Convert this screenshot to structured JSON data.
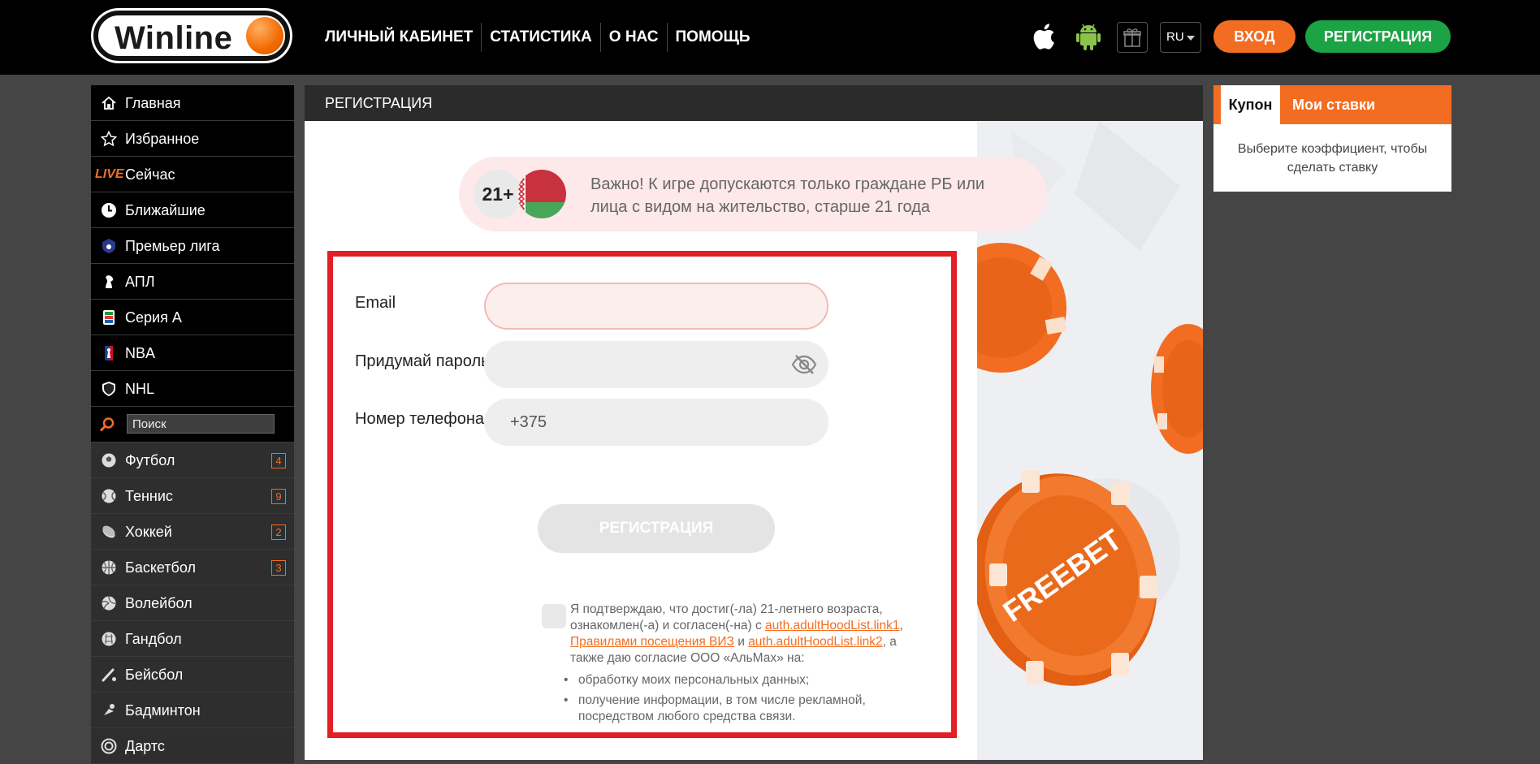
{
  "header": {
    "logo_text": "Winline",
    "nav": [
      "ЛИЧНЫЙ КАБИНЕТ",
      "СТАТИСТИКА",
      "О НАС",
      "ПОМОЩЬ"
    ],
    "lang": "RU",
    "login_label": "ВХОД",
    "register_label": "РЕГИСТРАЦИЯ"
  },
  "sidebar": {
    "top_items": [
      {
        "label": "Главная",
        "icon": "home-icon"
      },
      {
        "label": "Избранное",
        "icon": "star-icon"
      },
      {
        "label": "Сейчас",
        "icon": "live-icon",
        "tag": "LIVE"
      },
      {
        "label": "Ближайшие",
        "icon": "clock-icon"
      },
      {
        "label": "Премьер лига",
        "icon": "premier-league-icon"
      },
      {
        "label": "АПЛ",
        "icon": "epl-icon"
      },
      {
        "label": "Серия А",
        "icon": "serie-a-icon"
      },
      {
        "label": "NBA",
        "icon": "nba-icon"
      },
      {
        "label": "NHL",
        "icon": "nhl-icon"
      }
    ],
    "search_placeholder": "Поиск",
    "sports": [
      {
        "label": "Футбол",
        "count": "4",
        "icon": "football-icon"
      },
      {
        "label": "Теннис",
        "count": "9",
        "icon": "tennis-icon"
      },
      {
        "label": "Хоккей",
        "count": "2",
        "icon": "hockey-icon"
      },
      {
        "label": "Баскетбол",
        "count": "3",
        "icon": "basketball-icon"
      },
      {
        "label": "Волейбол",
        "count": "",
        "icon": "volleyball-icon"
      },
      {
        "label": "Гандбол",
        "count": "",
        "icon": "handball-icon"
      },
      {
        "label": "Бейсбол",
        "count": "",
        "icon": "baseball-icon"
      },
      {
        "label": "Бадминтон",
        "count": "",
        "icon": "badminton-icon"
      },
      {
        "label": "Дартс",
        "count": "",
        "icon": "darts-icon"
      }
    ]
  },
  "main": {
    "title": "РЕГИСТРАЦИЯ",
    "notice": {
      "age": "21+",
      "text": "Важно! К игре допускаются только граждане РБ или лица с видом на жительство, старше 21 года"
    },
    "form": {
      "email_label": "Email",
      "email_value": "",
      "password_label": "Придумай пароль",
      "password_value": "",
      "phone_label": "Номер телефона",
      "phone_value": "+375",
      "submit_label": "РЕГИСТРАЦИЯ",
      "agree_prefix": "Я подтверждаю, что достиг(-ла) 21-летнего возраста, ознакомлен(-а) и согласен(-на) с ",
      "link1": "auth.adultHoodList.link1",
      "comma": ",",
      "link_rules": "Правилами посещения ВИЗ",
      "and": " и ",
      "link2": "auth.adultHoodList.link2",
      "agree_suffix": ", а также даю согласие ООО «АльМах» на:",
      "bullet1": "обработку моих персональных данных;",
      "bullet2": "получение информации, в том числе рекламной, посредством любого средства связи."
    },
    "promo_text": "FREEBET"
  },
  "coupon": {
    "tab_coupon": "Купон",
    "tab_bets": "Мои ставки",
    "message": "Выберите коэффициент, чтобы сделать ставку"
  },
  "colors": {
    "accent": "#f26d21",
    "green": "#1ba345",
    "highlight_border": "#e31e24"
  }
}
